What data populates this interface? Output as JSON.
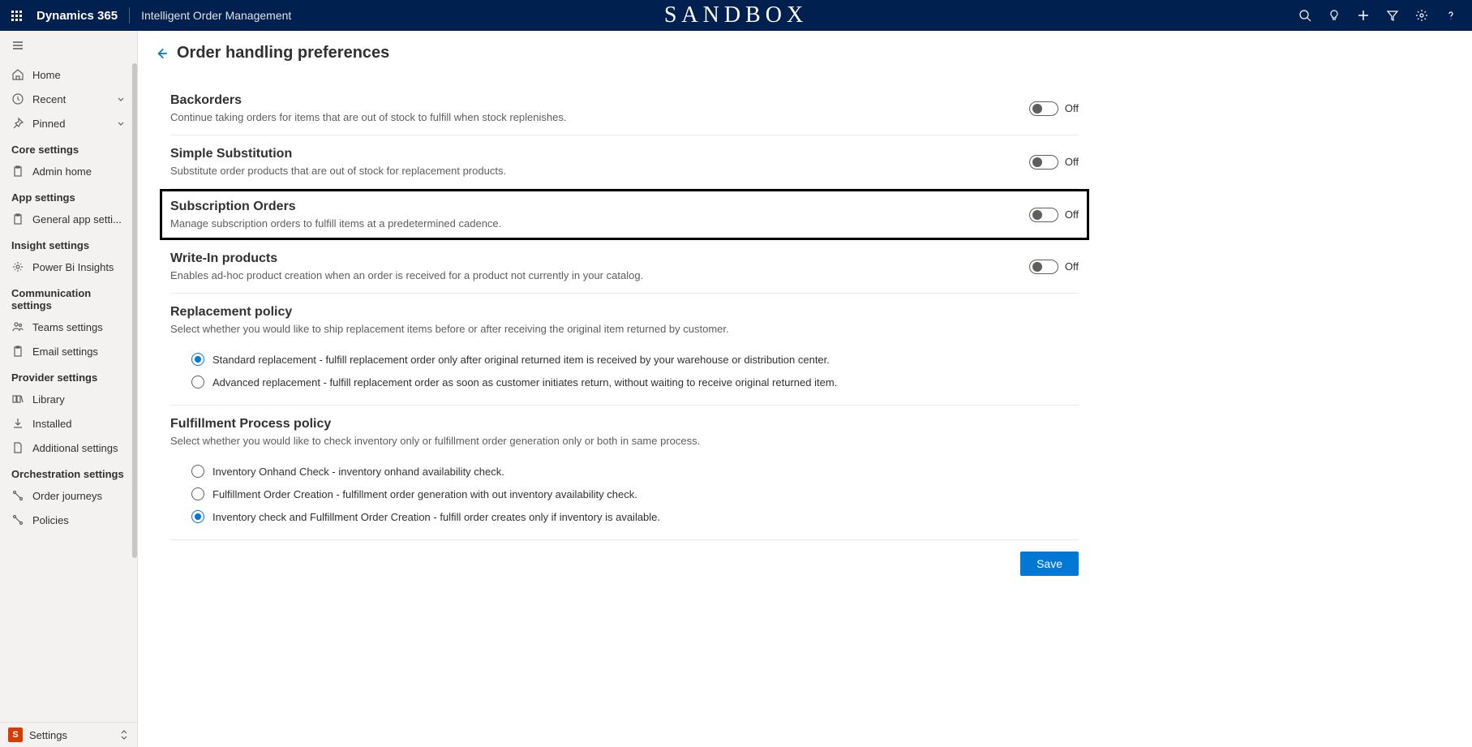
{
  "topbar": {
    "brand": "Dynamics 365",
    "app": "Intelligent Order Management",
    "env": "SANDBOX"
  },
  "sidebar": {
    "home": "Home",
    "recent": "Recent",
    "pinned": "Pinned",
    "groups": {
      "core": {
        "label": "Core settings",
        "admin_home": "Admin home"
      },
      "app": {
        "label": "App settings",
        "general": "General app setti..."
      },
      "insight": {
        "label": "Insight settings",
        "powerbi": "Power Bi Insights"
      },
      "comm": {
        "label": "Communication settings",
        "teams": "Teams settings",
        "email": "Email settings"
      },
      "provider": {
        "label": "Provider settings",
        "library": "Library",
        "installed": "Installed",
        "additional": "Additional settings"
      },
      "orch": {
        "label": "Orchestration settings",
        "journeys": "Order journeys",
        "policies": "Policies"
      }
    },
    "footer": {
      "badge": "S",
      "label": "Settings"
    }
  },
  "page": {
    "title": "Order handling preferences",
    "settings": {
      "backorders": {
        "title": "Backorders",
        "desc": "Continue taking orders for items that are out of stock to fulfill when stock replenishes.",
        "state": "Off"
      },
      "substitution": {
        "title": "Simple Substitution",
        "desc": "Substitute order products that are out of stock for replacement products.",
        "state": "Off"
      },
      "subscription": {
        "title": "Subscription Orders",
        "desc": "Manage subscription orders to fulfill items at a predetermined cadence.",
        "state": "Off"
      },
      "writein": {
        "title": "Write-In products",
        "desc": "Enables ad-hoc product creation when an order is received for a product not currently in your catalog.",
        "state": "Off"
      },
      "replacement": {
        "title": "Replacement policy",
        "desc": "Select whether you would like to ship replacement items before or after receiving the original item returned by customer.",
        "opt1": "Standard replacement - fulfill replacement order only after original returned item is received by your warehouse or distribution center.",
        "opt2": "Advanced replacement - fulfill replacement order as soon as customer initiates return, without waiting to receive original returned item."
      },
      "fulfillment": {
        "title": "Fulfillment Process policy",
        "desc": "Select whether you would like to check inventory only or fulfillment order generation only or both in same process.",
        "opt1": "Inventory Onhand Check - inventory onhand availability check.",
        "opt2": "Fulfillment Order Creation - fulfillment order generation with out inventory availability check.",
        "opt3": "Inventory check and Fulfillment Order Creation - fulfill order creates only if inventory is available."
      }
    },
    "save": "Save"
  }
}
